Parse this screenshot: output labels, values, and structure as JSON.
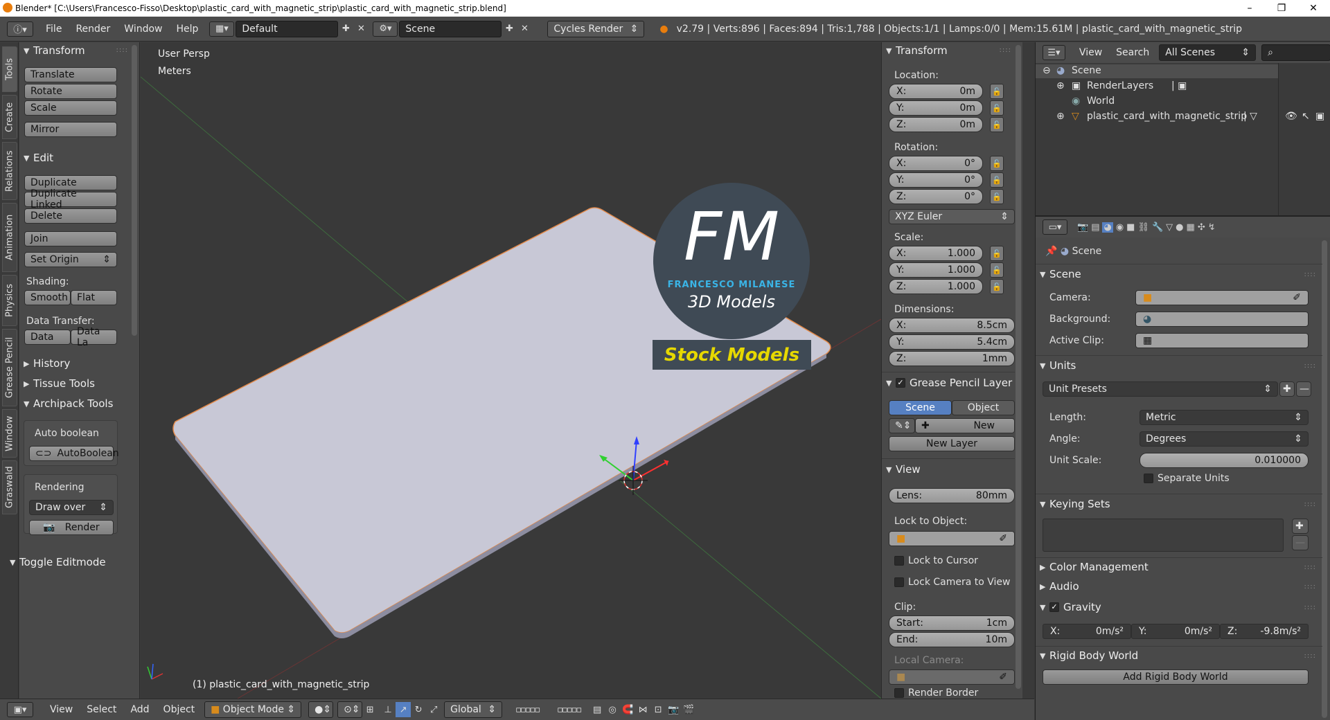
{
  "window": {
    "title": "Blender* [C:\\Users\\Francesco-Fisso\\Desktop\\plastic_card_with_magnetic_strip\\plastic_card_with_magnetic_strip.blend]",
    "minimize": "–",
    "maximize": "❐",
    "close": "✕"
  },
  "topbar": {
    "menus": [
      "File",
      "Render",
      "Window",
      "Help"
    ],
    "layout": "Default",
    "scene": "Scene",
    "engine": "Cycles Render",
    "stats": "v2.79 | Verts:896 | Faces:894 | Tris:1,788 | Objects:1/1 | Lamps:0/0 | Mem:15.61M | plastic_card_with_magnetic_strip"
  },
  "tabs": [
    "Tools",
    "Create",
    "Relations",
    "Animation",
    "Physics",
    "Grease Pencil",
    "Window",
    "Graswald"
  ],
  "tools": {
    "transform_header": "Transform",
    "translate": "Translate",
    "rotate": "Rotate",
    "scale": "Scale",
    "mirror": "Mirror",
    "edit_header": "Edit",
    "duplicate": "Duplicate",
    "duplicate_linked": "Duplicate Linked",
    "delete": "Delete",
    "join": "Join",
    "set_origin": "Set Origin",
    "shading_label": "Shading:",
    "smooth": "Smooth",
    "flat": "Flat",
    "data_transfer_label": "Data Transfer:",
    "data": "Data",
    "data_la": "Data La",
    "history": "History",
    "tissue": "Tissue Tools",
    "archipack": "Archipack Tools",
    "auto_boolean_label": "Auto boolean",
    "auto_boolean_btn": "AutoBoolean",
    "rendering_label": "Rendering",
    "draw_over": "Draw over",
    "render": "Render",
    "toggle_editmode": "Toggle Editmode"
  },
  "viewport": {
    "persp": "User Persp",
    "units": "Meters",
    "object_label": "(1) plastic_card_with_magnetic_strip",
    "logo_letters": "FM",
    "logo_name": "FRANCESCO MILANESE",
    "logo_sub": "3D Models",
    "logo_banner": "Stock Models"
  },
  "npanel": {
    "transform_header": "Transform",
    "location_label": "Location:",
    "loc": [
      {
        "a": "X:",
        "v": "0m"
      },
      {
        "a": "Y:",
        "v": "0m"
      },
      {
        "a": "Z:",
        "v": "0m"
      }
    ],
    "rotation_label": "Rotation:",
    "rot": [
      {
        "a": "X:",
        "v": "0°"
      },
      {
        "a": "Y:",
        "v": "0°"
      },
      {
        "a": "Z:",
        "v": "0°"
      }
    ],
    "rot_mode": "XYZ Euler",
    "scale_label": "Scale:",
    "scl": [
      {
        "a": "X:",
        "v": "1.000"
      },
      {
        "a": "Y:",
        "v": "1.000"
      },
      {
        "a": "Z:",
        "v": "1.000"
      }
    ],
    "dims_label": "Dimensions:",
    "dims": [
      {
        "a": "X:",
        "v": "8.5cm"
      },
      {
        "a": "Y:",
        "v": "5.4cm"
      },
      {
        "a": "Z:",
        "v": "1mm"
      }
    ],
    "gp_header": "Grease Pencil Layer",
    "gp_scene": "Scene",
    "gp_object": "Object",
    "gp_new": "New",
    "gp_new_layer": "New Layer",
    "view_header": "View",
    "lens_label": "Lens:",
    "lens_value": "80mm",
    "lock_obj_label": "Lock to Object:",
    "lock_cursor": "Lock to Cursor",
    "lock_camera": "Lock Camera to View",
    "clip_label": "Clip:",
    "clip_start_label": "Start:",
    "clip_start": "1cm",
    "clip_end_label": "End:",
    "clip_end": "10m",
    "local_camera": "Local Camera:",
    "render_border": "Render Border"
  },
  "outliner": {
    "view": "View",
    "search": "Search",
    "filter": "All Scenes",
    "items": {
      "scene": "Scene",
      "renderlayers": "RenderLayers",
      "world": "World",
      "object": "plastic_card_with_magnetic_strip"
    }
  },
  "props": {
    "context": "Scene",
    "scene_header": "Scene",
    "camera_label": "Camera:",
    "background_label": "Background:",
    "active_clip_label": "Active Clip:",
    "units_header": "Units",
    "unit_presets": "Unit Presets",
    "length_label": "Length:",
    "length_value": "Metric",
    "angle_label": "Angle:",
    "angle_value": "Degrees",
    "unit_scale_label": "Unit Scale:",
    "unit_scale_value": "0.010000",
    "separate_units": "Separate Units",
    "keying_header": "Keying Sets",
    "color_mgmt": "Color Management",
    "audio": "Audio",
    "gravity": "Gravity",
    "grav": [
      {
        "a": "X:",
        "v": "0m/s²"
      },
      {
        "a": "Y:",
        "v": "0m/s²"
      },
      {
        "a": "Z:",
        "v": "-9.8m/s²"
      }
    ],
    "rigid_header": "Rigid Body World",
    "add_rigid": "Add Rigid Body World"
  },
  "bottombar": {
    "view": "View",
    "select": "Select",
    "add": "Add",
    "object": "Object",
    "mode": "Object Mode",
    "orientation": "Global"
  }
}
